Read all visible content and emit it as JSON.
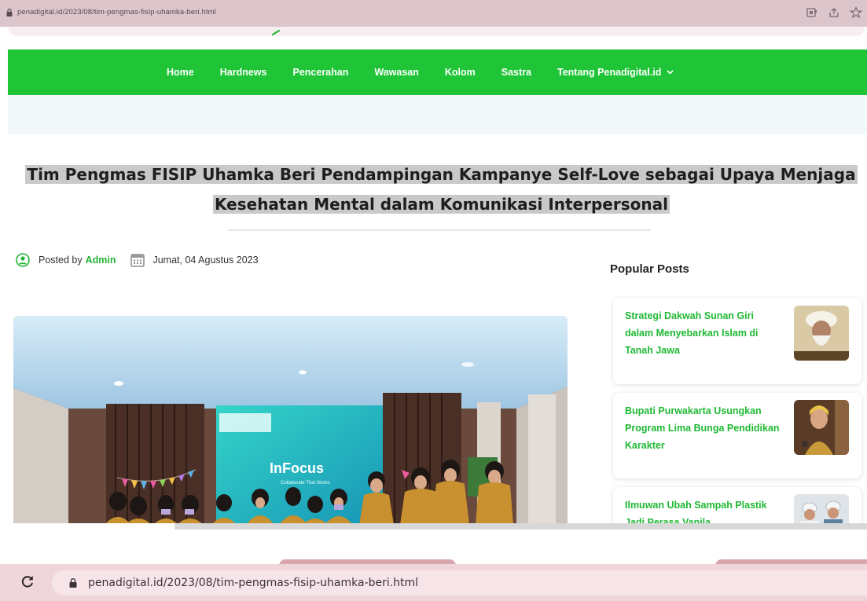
{
  "browser": {
    "url": "penadigital.id/2023/08/tim-pengmas-fisip-uhamka-beri.html"
  },
  "nav": {
    "items": [
      "Home",
      "Hardnews",
      "Pencerahan",
      "Wawasan",
      "Kolom",
      "Sastra"
    ],
    "dropdown_label": "Tentang Penadigital.id",
    "accent_color": "#20c537"
  },
  "article": {
    "title_line1": "Tim Pengmas FISIP Uhamka Beri Pendampingan Kampanye Self-Love sebagai Upaya Menjaga",
    "title_line2": "Kesehatan Mental dalam Komunikasi Interpersonal",
    "posted_by_label": "Posted by",
    "author": "Admin",
    "date": "Jumat, 04 Agustus 2023",
    "image": {
      "screen_text": "InFocus",
      "screen_subtext": "Collaborate That Works"
    }
  },
  "sidebar": {
    "heading": "Popular Posts",
    "posts": [
      {
        "title": "Strategi Dakwah Sunan Giri dalam Menyebarkan Islam di Tanah Jawa"
      },
      {
        "title": "Bupati Purwakarta Usungkan Program Lima Bunga Pendidikan Karakter"
      },
      {
        "title": "Ilmuwan Ubah Sampah Plastik Jadi Perasa Vanila"
      }
    ]
  },
  "icons": {
    "lock": "lock-icon",
    "reload": "reload-icon",
    "user": "user-circle-icon",
    "calendar": "calendar-icon",
    "star": "star-icon",
    "share": "share-icon",
    "extension": "extension-icon",
    "chevron": "chevron-down-icon"
  }
}
